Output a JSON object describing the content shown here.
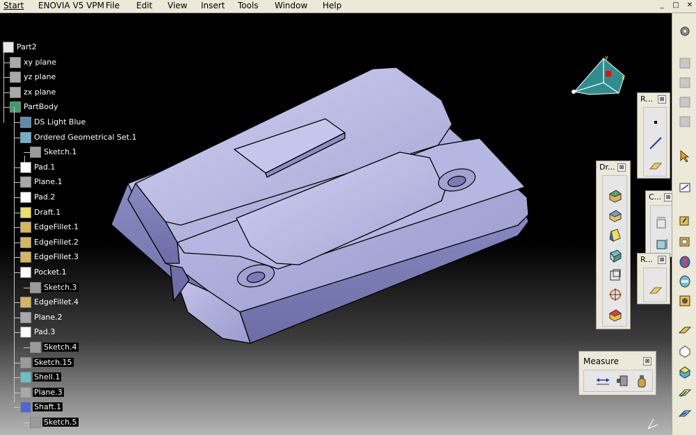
{
  "menubar": {
    "items": [
      "Start",
      "ENOVIA V5 VPM",
      "File",
      "Edit",
      "View",
      "Insert",
      "Tools",
      "Window",
      "Help"
    ],
    "window_controls": [
      "_",
      "□",
      "✕"
    ]
  },
  "tree": {
    "nodes": [
      {
        "label": "Part2",
        "icon": "part-icon"
      },
      {
        "label": "xy plane",
        "icon": "plane-icon"
      },
      {
        "label": "yz plane",
        "icon": "plane-icon"
      },
      {
        "label": "zx plane",
        "icon": "plane-icon"
      },
      {
        "label": "PartBody",
        "icon": "body-gear-icon"
      },
      {
        "label": "DS Light Blue",
        "icon": "material-sphere-icon"
      },
      {
        "label": "Ordered Geometrical Set.1",
        "icon": "geometrical-set-icon"
      },
      {
        "label": "Sketch.1",
        "icon": "sketch-icon"
      },
      {
        "label": "Pad.1",
        "icon": "pad-icon"
      },
      {
        "label": "Plane.1",
        "icon": "plane-icon"
      },
      {
        "label": "Pad.2",
        "icon": "pad-icon"
      },
      {
        "label": "Draft.1",
        "icon": "draft-icon"
      },
      {
        "label": "EdgeFillet.1",
        "icon": "edge-fillet-icon"
      },
      {
        "label": "EdgeFillet.2",
        "icon": "edge-fillet-icon"
      },
      {
        "label": "EdgeFillet.3",
        "icon": "edge-fillet-icon"
      },
      {
        "label": "Pocket.1",
        "icon": "pocket-icon"
      },
      {
        "label": "Sketch.3",
        "icon": "sketch-icon"
      },
      {
        "label": "EdgeFillet.4",
        "icon": "edge-fillet-icon"
      },
      {
        "label": "Plane.2",
        "icon": "plane-icon"
      },
      {
        "label": "Pad.3",
        "icon": "pad-icon"
      },
      {
        "label": "Sketch.4",
        "icon": "sketch-icon"
      },
      {
        "label": "Sketch.15",
        "icon": "sketch-icon"
      },
      {
        "label": "Shell.1",
        "icon": "shell-icon"
      },
      {
        "label": "Plane.3",
        "icon": "plane-icon"
      },
      {
        "label": "Shaft.1",
        "icon": "shaft-icon"
      },
      {
        "label": "Sketch.5",
        "icon": "sketch-icon"
      }
    ]
  },
  "toolbars": {
    "reference": {
      "title": "R...",
      "close": "⊠"
    },
    "dress_up": {
      "title": "Dr...",
      "close": "⊠"
    },
    "constraints": {
      "title": "C...",
      "close": "⊠"
    },
    "reference2": {
      "title": "R...",
      "close": "⊠"
    },
    "measure": {
      "title": "Measure",
      "close": "⊠"
    }
  },
  "colors": {
    "menubar": "#ece9d8",
    "part_face": "#a9a9d6",
    "part_edge": "#000000",
    "compass_fill": "#2f8e8c",
    "compass_accent": "#ff0000"
  }
}
